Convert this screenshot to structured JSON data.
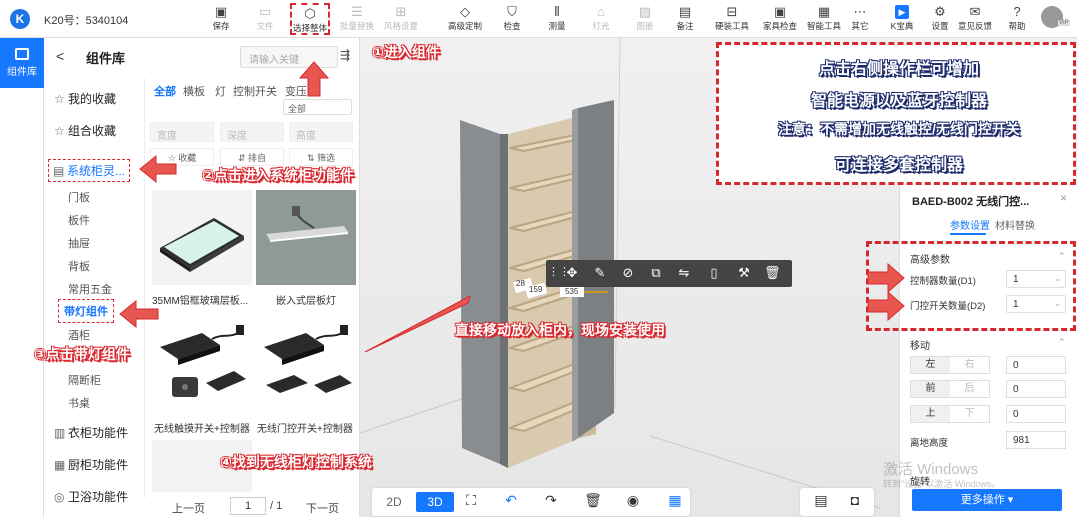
{
  "app": {
    "id_label": "K20号：5340104"
  },
  "toolbar": {
    "items": [
      {
        "label": "保存",
        "icon": "save-icon",
        "disabled": false
      },
      {
        "label": "文件",
        "icon": "file-icon",
        "disabled": true
      },
      {
        "label": "选择整体",
        "icon": "cube-icon",
        "disabled": false,
        "selected": true
      },
      {
        "label": "批量替换",
        "icon": "list-icon",
        "disabled": true
      },
      {
        "label": "风格设置",
        "icon": "grid-icon",
        "disabled": true
      },
      {
        "label": "高级定制",
        "icon": "diamond-icon",
        "disabled": false
      },
      {
        "label": "检查",
        "icon": "shield-icon",
        "disabled": false
      },
      {
        "label": "测量",
        "icon": "measure-icon",
        "disabled": false
      },
      {
        "label": "灯光",
        "icon": "building-icon",
        "disabled": true
      },
      {
        "label": "图册",
        "icon": "image-icon",
        "disabled": true
      },
      {
        "label": "备注",
        "icon": "note-icon",
        "disabled": false
      },
      {
        "label": "硬装工具",
        "icon": "tool-icon",
        "disabled": false
      },
      {
        "label": "家具检查",
        "icon": "furniture-icon",
        "disabled": false
      },
      {
        "label": "智能工具",
        "icon": "chip-icon",
        "disabled": false
      },
      {
        "label": "其它",
        "icon": "more-icon",
        "disabled": false
      },
      {
        "label": "K宝典",
        "icon": "book-icon",
        "disabled": false
      },
      {
        "label": "设置",
        "icon": "gear-icon",
        "disabled": false
      },
      {
        "label": "意见反馈",
        "icon": "feedback-icon",
        "disabled": false
      },
      {
        "label": "帮助",
        "icon": "help-icon",
        "disabled": false
      }
    ],
    "vip": "VIP"
  },
  "rail": {
    "tab_label": "组件库"
  },
  "panel": {
    "title": "组件库",
    "back": "<",
    "search_placeholder": "请输入关键",
    "categories": [
      {
        "label": "我的收藏",
        "icon": "star-icon"
      },
      {
        "label": "组合收藏",
        "icon": "star-icon"
      },
      {
        "label": "系统柜灵...",
        "icon": "cabinet-icon",
        "active": true
      },
      {
        "label": "衣柜功能件",
        "icon": "wardrobe-icon"
      },
      {
        "label": "厨柜功能件",
        "icon": "kitchen-icon"
      },
      {
        "label": "卫浴功能件",
        "icon": "bath-icon"
      }
    ],
    "subcats": [
      "门板",
      "板件",
      "抽屉",
      "背板",
      "常用五金",
      "带灯组件",
      "酒柜",
      "隔断柜",
      "书桌"
    ],
    "filter_tabs": [
      "全部",
      "横板",
      "灯",
      "控制开关",
      "变压器"
    ],
    "filter_all": "全部",
    "dims": [
      "宽度",
      "深度",
      "高度"
    ],
    "actions": [
      "收藏",
      "排自",
      "筛选"
    ],
    "items": [
      {
        "label": "35MM铝框玻璃层板..."
      },
      {
        "label": "嵌入式层板灯"
      },
      {
        "label": "无线触摸开关+控制器"
      },
      {
        "label": "无线门控开关+控制器"
      }
    ],
    "pager": {
      "prev": "上一页",
      "page": "1",
      "total": "/ 1",
      "next": "下一页"
    }
  },
  "viewport": {
    "dim_labels": [
      "28",
      "159",
      "535"
    ],
    "view_2d": "2D",
    "view_3d": "3D"
  },
  "props": {
    "title": "BAED-B002 无线门控...",
    "tabs": [
      "参数设置",
      "材料替换"
    ],
    "advanced_title": "高级参数",
    "controller_label": "控制器数量(D1)",
    "controller_value": "1",
    "door_label": "门控开关数量(D2)",
    "door_value": "1",
    "move_title": "移动",
    "moves": [
      {
        "a": "左",
        "b": "右",
        "value": "0"
      },
      {
        "a": "前",
        "b": "后",
        "value": "0"
      },
      {
        "a": "上",
        "b": "下",
        "value": "0"
      }
    ],
    "height_label": "离地高度",
    "height_value": "981",
    "more_btn": "更多操作 ▾",
    "cut_label": "旋转"
  },
  "annotations": {
    "step1": "①进入组件",
    "step2": "②点击进入系统柜功能件",
    "step3": "③点击带灯组件",
    "step4": "④找到无线柜灯控制系统",
    "move_tip": "直接移动放入柜内，现场安装使用",
    "box_lines": [
      "点击右侧操作栏可增加",
      "智能电源以及蓝牙控制器",
      "注意：不需增加无线触控/无线门控开关",
      "可连接多套控制器"
    ]
  },
  "watermark": {
    "title": "激活 Windows",
    "sub": "转到\"设置\"以激活 Windows。"
  }
}
